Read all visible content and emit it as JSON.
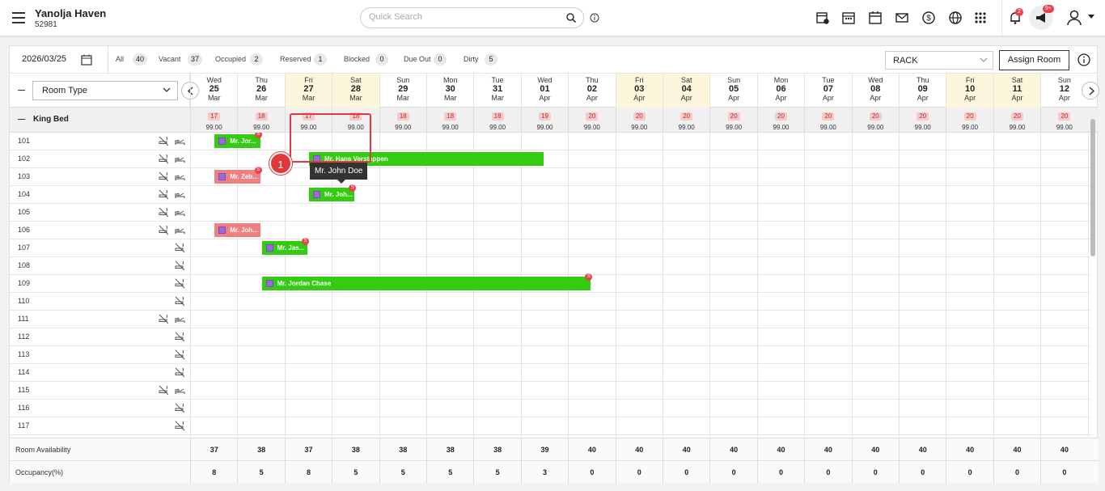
{
  "header": {
    "hotel_name": "Yanolja Haven",
    "hotel_id": "52981",
    "search_placeholder": "Quick Search",
    "notif_count": "2",
    "announce_count": "9+"
  },
  "filters": {
    "date": "2026/03/25",
    "items": [
      {
        "label": "All",
        "count": "40"
      },
      {
        "label": "Vacant",
        "count": "37"
      },
      {
        "label": "Occupied",
        "count": "2"
      },
      {
        "label": "Reserved",
        "count": "1"
      },
      {
        "label": "Blocked",
        "count": "0"
      },
      {
        "label": "Due Out",
        "count": "0"
      },
      {
        "label": "Dirty",
        "count": "5"
      }
    ],
    "rate_plan": "RACK",
    "assign_label": "Assign Room"
  },
  "room_type_select": "Room Type",
  "dates": [
    {
      "dow": "Wed",
      "day": "25",
      "mon": "Mar",
      "we": false
    },
    {
      "dow": "Thu",
      "day": "26",
      "mon": "Mar",
      "we": false
    },
    {
      "dow": "Fri",
      "day": "27",
      "mon": "Mar",
      "we": true
    },
    {
      "dow": "Sat",
      "day": "28",
      "mon": "Mar",
      "we": true
    },
    {
      "dow": "Sun",
      "day": "29",
      "mon": "Mar",
      "we": false
    },
    {
      "dow": "Mon",
      "day": "30",
      "mon": "Mar",
      "we": false
    },
    {
      "dow": "Tue",
      "day": "31",
      "mon": "Mar",
      "we": false
    },
    {
      "dow": "Wed",
      "day": "01",
      "mon": "Apr",
      "we": false
    },
    {
      "dow": "Thu",
      "day": "02",
      "mon": "Apr",
      "we": false
    },
    {
      "dow": "Fri",
      "day": "03",
      "mon": "Apr",
      "we": true
    },
    {
      "dow": "Sat",
      "day": "04",
      "mon": "Apr",
      "we": true
    },
    {
      "dow": "Sun",
      "day": "05",
      "mon": "Apr",
      "we": false
    },
    {
      "dow": "Mon",
      "day": "06",
      "mon": "Apr",
      "we": false
    },
    {
      "dow": "Tue",
      "day": "07",
      "mon": "Apr",
      "we": false
    },
    {
      "dow": "Wed",
      "day": "08",
      "mon": "Apr",
      "we": false
    },
    {
      "dow": "Thu",
      "day": "09",
      "mon": "Apr",
      "we": false
    },
    {
      "dow": "Fri",
      "day": "10",
      "mon": "Apr",
      "we": true
    },
    {
      "dow": "Sat",
      "day": "11",
      "mon": "Apr",
      "we": true
    },
    {
      "dow": "Sun",
      "day": "12",
      "mon": "Apr",
      "we": false
    }
  ],
  "group": {
    "name": "King Bed",
    "avail": [
      "17",
      "18",
      "17",
      "18",
      "18",
      "18",
      "18",
      "19",
      "20",
      "20",
      "20",
      "20",
      "20",
      "20",
      "20",
      "20",
      "20",
      "20",
      "20"
    ],
    "price": "99.00"
  },
  "rooms": [
    {
      "no": "101",
      "smoke": true,
      "bed": true
    },
    {
      "no": "102",
      "smoke": true,
      "bed": true
    },
    {
      "no": "103",
      "smoke": true,
      "bed": true
    },
    {
      "no": "104",
      "smoke": true,
      "bed": true
    },
    {
      "no": "105",
      "smoke": true,
      "bed": true
    },
    {
      "no": "106",
      "smoke": true,
      "bed": true
    },
    {
      "no": "107",
      "smoke": false,
      "bed": true
    },
    {
      "no": "108",
      "smoke": false,
      "bed": true
    },
    {
      "no": "109",
      "smoke": false,
      "bed": true
    },
    {
      "no": "110",
      "smoke": false,
      "bed": true
    },
    {
      "no": "111",
      "smoke": true,
      "bed": true
    },
    {
      "no": "112",
      "smoke": false,
      "bed": true
    },
    {
      "no": "113",
      "smoke": false,
      "bed": true
    },
    {
      "no": "114",
      "smoke": false,
      "bed": true
    },
    {
      "no": "115",
      "smoke": true,
      "bed": true
    },
    {
      "no": "116",
      "smoke": false,
      "bed": true
    },
    {
      "no": "117",
      "smoke": false,
      "bed": true
    }
  ],
  "bookings": [
    {
      "row": 0,
      "start": 0.5,
      "span": 1.0,
      "name": "Mr. Jor...",
      "color": "g",
      "badge": "S"
    },
    {
      "row": 1,
      "start": 2.5,
      "span": 5.0,
      "name": "Mr. Hans Verstappen",
      "color": "g",
      "badge": ""
    },
    {
      "row": 2,
      "start": 0.5,
      "span": 1.0,
      "name": "Mr. Zeb...",
      "color": "r",
      "badge": "S"
    },
    {
      "row": 3,
      "start": 2.5,
      "span": 1.0,
      "name": "Mr. Joh...",
      "color": "g",
      "badge": "S"
    },
    {
      "row": 5,
      "start": 0.5,
      "span": 1.0,
      "name": "Mr. Joh...",
      "color": "r",
      "badge": ""
    },
    {
      "row": 6,
      "start": 1.5,
      "span": 1.0,
      "name": "Mr. Jas...",
      "color": "g",
      "badge": "S"
    },
    {
      "row": 8,
      "start": 1.5,
      "span": 7.0,
      "name": "Mr. Jordan Chase",
      "color": "g",
      "badge": "S"
    }
  ],
  "tooltip": "Mr. John Doe",
  "step_number": "1",
  "footer": {
    "availability_label": "Room Availability",
    "availability": [
      "37",
      "38",
      "37",
      "38",
      "38",
      "38",
      "38",
      "39",
      "40",
      "40",
      "40",
      "40",
      "40",
      "40",
      "40",
      "40",
      "40",
      "40",
      "40"
    ],
    "occupancy_label": "Occupancy(%)",
    "occupancy": [
      "8",
      "5",
      "8",
      "5",
      "5",
      "5",
      "5",
      "3",
      "0",
      "0",
      "0",
      "0",
      "0",
      "0",
      "0",
      "0",
      "0",
      "0",
      "0"
    ]
  },
  "colors": {
    "booking_green": "#33cc11",
    "booking_red": "#f08080",
    "weekend": "#fdf6dc",
    "highlight": "#e23a3a"
  }
}
